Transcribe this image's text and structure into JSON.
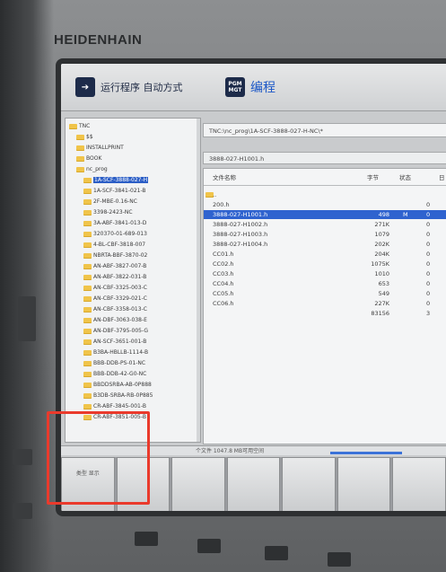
{
  "brand": "HEIDENHAIN",
  "modes": {
    "auto_label": "运行程序 自动方式",
    "prog_icon": "PGM MGT",
    "prog_label": "编程"
  },
  "tree": [
    {
      "label": "TNC",
      "level": 0
    },
    {
      "label": "$$",
      "level": 1
    },
    {
      "label": "INSTALLPRINT",
      "level": 1
    },
    {
      "label": "BOOK",
      "level": 1
    },
    {
      "label": "nc_prog",
      "level": 1
    },
    {
      "label": "1A-SCF-3888-027-H",
      "level": 2,
      "selected": true
    },
    {
      "label": "1A-SCF-3841-021-B",
      "level": 2
    },
    {
      "label": "2F-MBE-0.16-NC",
      "level": 2
    },
    {
      "label": "3398-2423-NC",
      "level": 2
    },
    {
      "label": "3A-ABF-3841-013-D",
      "level": 2
    },
    {
      "label": "320370-01-689-013",
      "level": 2
    },
    {
      "label": "4-BL-CBF-3818-007",
      "level": 2
    },
    {
      "label": "NBRTA-BBF-3870-02",
      "level": 2
    },
    {
      "label": "AN-ABF-3827-007-B",
      "level": 2
    },
    {
      "label": "AN-ABF-3822-031-B",
      "level": 2
    },
    {
      "label": "AN-CBF-3325-003-C",
      "level": 2
    },
    {
      "label": "AN-CBF-3329-021-C",
      "level": 2
    },
    {
      "label": "AN-CBF-3358-013-C",
      "level": 2
    },
    {
      "label": "AN-DBF-3063-038-E",
      "level": 2
    },
    {
      "label": "AN-DBF-3795-005-G",
      "level": 2
    },
    {
      "label": "AN-SCF-3651-001-B",
      "level": 2
    },
    {
      "label": "B3BA-HBLLB-1114-B",
      "level": 2
    },
    {
      "label": "BBB-DDB-PS-01-NC",
      "level": 2
    },
    {
      "label": "BBB-DDB-42-G0-NC",
      "level": 2
    },
    {
      "label": "BBDDSRBA-AB-0P888",
      "level": 2
    },
    {
      "label": "B3DB-SRBA-RB-0P885",
      "level": 2
    },
    {
      "label": "CR-ABF-3845-001-B",
      "level": 2
    },
    {
      "label": "CR-ABF-3851-005-B",
      "level": 2
    }
  ],
  "path": "TNC:\\nc_prog\\1A-SCF-3888-027-H-NC\\*",
  "filename": "3888-027-H1001.h",
  "columns": {
    "name": "文件名称",
    "size": "字节",
    "status": "状态",
    "date": "日"
  },
  "files": [
    {
      "name": "..",
      "size": "",
      "status": "",
      "date": ""
    },
    {
      "name": "200.h",
      "size": "",
      "status": "",
      "date": "0"
    },
    {
      "name": "3888-027-H1001.h",
      "size": "498",
      "status": "M",
      "date": "0",
      "selected": true
    },
    {
      "name": "3888-027-H1002.h",
      "size": "271K",
      "status": "",
      "date": "0"
    },
    {
      "name": "3888-027-H1003.h",
      "size": "1079",
      "status": "",
      "date": "0"
    },
    {
      "name": "3888-027-H1004.h",
      "size": "202K",
      "status": "",
      "date": "0"
    },
    {
      "name": "CC01.h",
      "size": "204K",
      "status": "",
      "date": "0"
    },
    {
      "name": "CC02.h",
      "size": "1075K",
      "status": "",
      "date": "0"
    },
    {
      "name": "CC03.h",
      "size": "1010",
      "status": "",
      "date": "0"
    },
    {
      "name": "CC04.h",
      "size": "653",
      "status": "",
      "date": "0"
    },
    {
      "name": "CC05.h",
      "size": "549",
      "status": "",
      "date": "0"
    },
    {
      "name": "CC06.h",
      "size": "227K",
      "status": "",
      "date": "0"
    },
    {
      "name": "",
      "size": "83156",
      "status": "",
      "date": "3"
    }
  ],
  "status_text": "个文件 1047.8 MB可用空间",
  "softkeys": [
    "类型 显示",
    "",
    "",
    "",
    "",
    "",
    ""
  ]
}
